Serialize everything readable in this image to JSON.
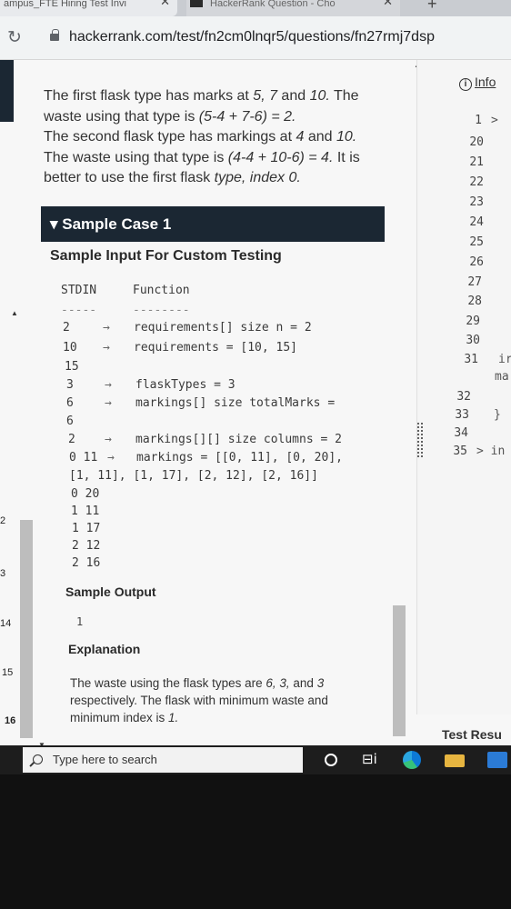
{
  "browser": {
    "tabs": [
      {
        "label": "ampus_FTE Hiring Test Invi",
        "close": "✕"
      },
      {
        "label": "HackerRank Question - Cho",
        "close": "✕"
      }
    ],
    "new_tab": "+",
    "url": "hackerrank.com/test/fn2cm0lnqr5/questions/fn27rmj7dsp"
  },
  "problem": {
    "explanation_lines": [
      {
        "plain": "The first flask type has marks at ",
        "em": "5, 7",
        "plain2": " and ",
        "em2": "10.",
        "plain3": " The"
      },
      {
        "plain": "waste using that type is ",
        "em": "(5-4 + 7-6) = 2.",
        "plain2": "",
        "em2": "",
        "plain3": ""
      },
      {
        "plain": "The second flask type has markings at ",
        "em": "4",
        "plain2": " and ",
        "em2": "10.",
        "plain3": ""
      },
      {
        "plain": "The waste using that type is ",
        "em": "(4-4 + 10-6) = 4.",
        "plain2": " It is",
        "em2": "",
        "plain3": ""
      },
      {
        "plain": "better to use the first flask ",
        "em": "type, index 0.",
        "plain2": "",
        "em2": "",
        "plain3": ""
      }
    ],
    "sample_case_title": "▾ Sample Case 1",
    "custom_testing_heading": "Sample Input For Custom Testing",
    "stdin_header": "STDIN",
    "function_header": "Function",
    "stdin_dash": "-----",
    "function_dash": "--------",
    "input_rows": [
      {
        "stdin": "2",
        "arrow": "→",
        "func": "requirements[] size n = 2"
      },
      {
        "stdin": "10",
        "arrow": "→",
        "func": "requirements = [10, 15]"
      },
      {
        "stdin": "15",
        "arrow": "",
        "func": ""
      },
      {
        "stdin": "3",
        "arrow": "→",
        "func": "flaskTypes = 3"
      },
      {
        "stdin": "6",
        "arrow": "→",
        "func": "markings[] size totalMarks ="
      },
      {
        "stdin": "6",
        "arrow": "",
        "func": ""
      },
      {
        "stdin": "2",
        "arrow": "→",
        "func": "markings[][] size columns = 2"
      },
      {
        "stdin": "0 11",
        "arrow": "→",
        "func": "markings = [[0, 11], [0, 20],"
      },
      {
        "stdin": "[1, 11], [1, 17], [2, 12], [2, 16]]",
        "arrow": "",
        "func": ""
      },
      {
        "stdin": "0 20",
        "arrow": "",
        "func": ""
      },
      {
        "stdin": "1 11",
        "arrow": "",
        "func": ""
      },
      {
        "stdin": "1 17",
        "arrow": "",
        "func": ""
      },
      {
        "stdin": "2 12",
        "arrow": "",
        "func": ""
      },
      {
        "stdin": "2 16",
        "arrow": "",
        "func": ""
      }
    ],
    "sample_output_heading": "Sample Output",
    "sample_output_value": "1",
    "explanation_heading": "Explanation",
    "explanation_text": {
      "line1_plain": "The waste using the flask types are ",
      "line1_em": "6, 3,",
      "line1_plain2": " and ",
      "line1_em2": "3",
      "line2": "respectively. The flask with minimum waste and",
      "line3_plain": "minimum index is ",
      "line3_em": "1."
    }
  },
  "left_gutter_numbers": [
    "2",
    "3",
    "14",
    "15",
    "16"
  ],
  "editor": {
    "info_label": "Info",
    "info_icon": "i",
    "lines": [
      {
        "num": "1",
        "code": ">"
      },
      {
        "num": "20",
        "code": ""
      },
      {
        "num": "21",
        "code": ""
      },
      {
        "num": "22",
        "code": ""
      },
      {
        "num": "23",
        "code": ""
      },
      {
        "num": "24",
        "code": ""
      },
      {
        "num": "25",
        "code": ""
      },
      {
        "num": "26",
        "code": ""
      },
      {
        "num": "27",
        "code": ""
      },
      {
        "num": "28",
        "code": ""
      },
      {
        "num": "29",
        "code": ""
      },
      {
        "num": "30",
        "code": ""
      },
      {
        "num": "31",
        "code": "ir"
      },
      {
        "num": "",
        "code": "ma"
      },
      {
        "num": "32",
        "code": ""
      },
      {
        "num": "33",
        "code": "}"
      },
      {
        "num": "34",
        "code": ""
      },
      {
        "num": "35",
        "code": "> in"
      }
    ],
    "test_results_label": "Test Resu"
  },
  "taskbar": {
    "search_placeholder": "Type here to search",
    "task_view_glyph": "⊟i"
  }
}
